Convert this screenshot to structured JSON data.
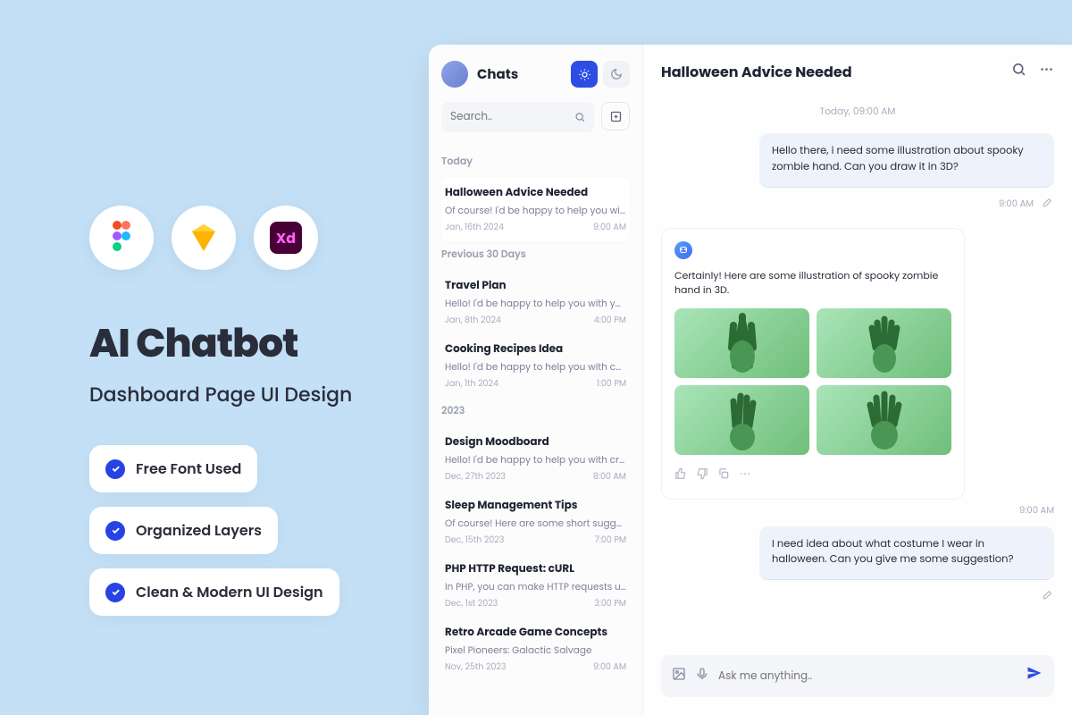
{
  "promo": {
    "title": "AI Chatbot",
    "subtitle": "Dashboard Page UI Design",
    "features": [
      "Free Font Used",
      "Organized Layers",
      "Clean & Modern UI Design"
    ]
  },
  "sidebar": {
    "title": "Chats",
    "search_placeholder": "Search..",
    "sections": [
      {
        "label": "Today",
        "items": [
          {
            "title": "Halloween Advice Needed",
            "preview": "Of course! I'd be happy to help you with..",
            "date": "Jan, 16th 2024",
            "time": "9:00 AM"
          }
        ]
      },
      {
        "label": "Previous 30 Days",
        "items": [
          {
            "title": "Travel Plan",
            "preview": "Hello! I'd be happy to help you with your..",
            "date": "Jan, 8th 2024",
            "time": "4:00 PM"
          },
          {
            "title": "Cooking Recipes Idea",
            "preview": "Hello! I'd be happy to help you with coo..",
            "date": "Jan, 1th 2024",
            "time": "1:00 PM"
          }
        ]
      },
      {
        "label": "2023",
        "items": [
          {
            "title": "Design Moodboard",
            "preview": "Hello! I'd be happy to help you with crea..",
            "date": "Dec, 27th 2023",
            "time": "8:00 AM"
          },
          {
            "title": "Sleep Management Tips",
            "preview": "Of course! Here are some short suggest..",
            "date": "Dec, 15th 2023",
            "time": "7:00 PM"
          },
          {
            "title": "PHP HTTP Request: cURL",
            "preview": "In PHP, you can make HTTP requests usi..",
            "date": "Dec, 1st 2023",
            "time": "3:00 PM"
          },
          {
            "title": "Retro Arcade Game Concepts",
            "preview": "Pixel Pioneers: Galactic Salvage",
            "date": "Nov, 25th 2023",
            "time": "9:00 AM"
          }
        ]
      }
    ]
  },
  "conversation": {
    "title": "Halloween Advice Needed",
    "day_stamp": "Today, 09:00 AM",
    "messages": {
      "user1": {
        "text": "Hello there, i need some illustration about spooky zombie hand. Can you draw it in 3D?",
        "time": "9:00 AM"
      },
      "bot1": {
        "text": "Certainly! Here are some illustration of spooky zombie hand in 3D.",
        "time": "9:00 AM"
      },
      "user2": {
        "text": "I need idea about what costume I wear in halloween. Can you give me some suggestion?"
      }
    }
  },
  "composer": {
    "placeholder": "Ask me anything.."
  }
}
